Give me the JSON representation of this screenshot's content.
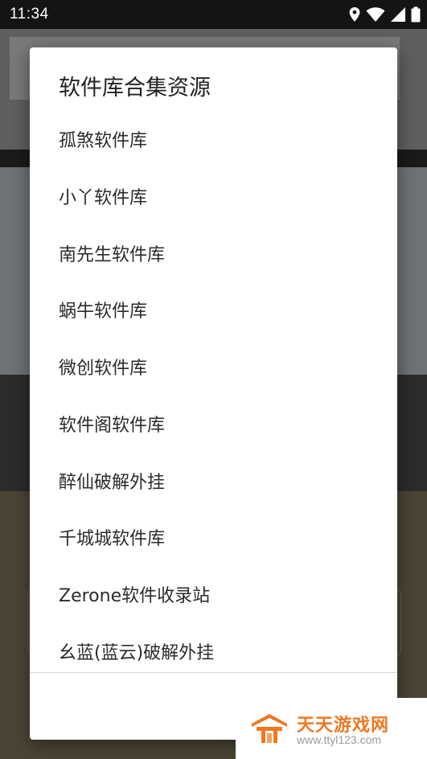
{
  "status_bar": {
    "time": "11:34"
  },
  "dialog": {
    "title": "软件库合集资源",
    "items": [
      "孤煞软件库",
      "小丫软件库",
      "南先生软件库",
      "蜗牛软件库",
      "微创软件库",
      "软件阁软件库",
      "醉仙破解外挂",
      "千城城软件库",
      "Zerone软件收录站",
      "幺蓝(蓝云)破解外挂"
    ]
  },
  "watermark": {
    "title": "天天游戏网",
    "url": "www.ttyl123.com"
  },
  "colors": {
    "dialog_bg": "#ffffff",
    "scrim": "#3a3a3a",
    "watermark_orange": "#f07722"
  }
}
